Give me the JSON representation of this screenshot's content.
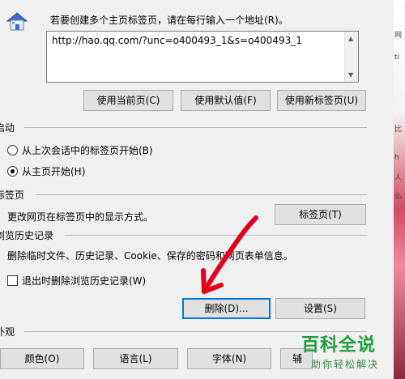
{
  "home": {
    "instruction": "若要创建多个主页标签页，请在每行输入一个地址(R)。",
    "url_value": "http://hao.qq.com/?unc=o400493_1&s=o400493_1",
    "use_current": "使用当前页(C)",
    "use_default": "使用默认值(F)",
    "use_newtab": "使用新标签页(U)"
  },
  "startup": {
    "title": "启动",
    "option_last": "从上次会话中的标签页开始(B)",
    "option_home": "从主页开始(H)",
    "selected": "option_home"
  },
  "tabs": {
    "title": "标签页",
    "desc": "更改网页在标签页中的显示方式。",
    "button": "标签页(T)"
  },
  "history": {
    "title": "浏览历史记录",
    "desc": "删除临时文件、历史记录、Cookie、保存的密码和网页表单信息。",
    "checkbox": "退出时删除浏览历史记录(W)",
    "checked": false,
    "delete_button": "删除(D)...",
    "settings_button": "设置(S)"
  },
  "appearance": {
    "title": "外观",
    "colors": "颜色(O)",
    "languages": "语言(L)",
    "fonts": "字体(N)",
    "accessibility": "辅"
  },
  "watermark": {
    "title": "百科全说",
    "subtitle": "助你轻松解决"
  },
  "background_strip": [
    "网",
    "ti",
    "比",
    "h",
    "人",
    "仏"
  ],
  "colors": {
    "accent": "#0078d7",
    "annotation_arrow": "#e0001b",
    "watermark": "#1f9e3d"
  }
}
